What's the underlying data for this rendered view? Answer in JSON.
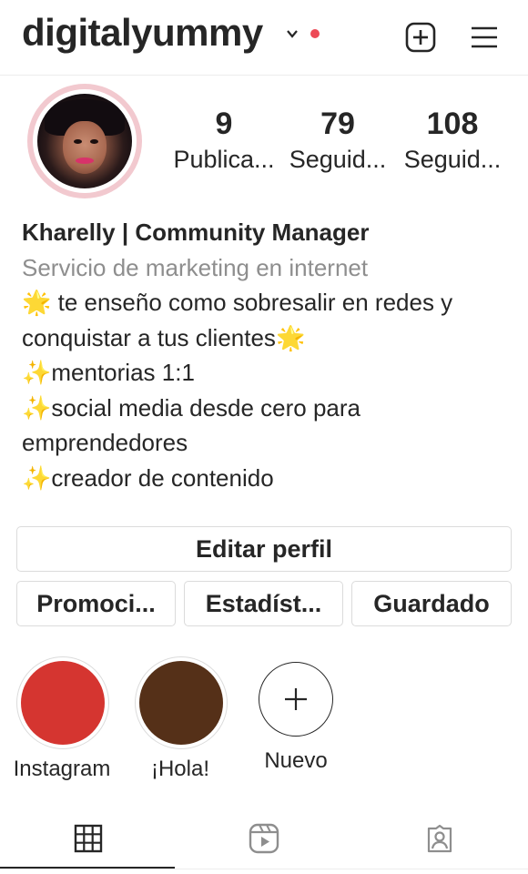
{
  "header": {
    "username": "digitalyummy",
    "chevron_icon": "chevron-down-icon",
    "notification_dot_color": "#ed4956",
    "new_post_icon": "plus-square-icon",
    "menu_icon": "hamburger-menu-icon"
  },
  "profile": {
    "avatar_ring_color": "#f2c9cf",
    "stats": [
      {
        "value": "9",
        "label": "Publica..."
      },
      {
        "value": "79",
        "label": "Seguid..."
      },
      {
        "value": "108",
        "label": "Seguid..."
      }
    ]
  },
  "bio": {
    "name": "Kharelly | Community Manager",
    "category": "Servicio de marketing en internet",
    "line1_emoji": "🌟",
    "line1": " te enseño como sobresalir en redes y",
    "line2": "conquistar a tus clientes",
    "line2_emoji": "🌟",
    "line3_emoji": "✨",
    "line3": "mentorias 1:1",
    "line4_emoji": "✨",
    "line4": "social media desde cero para",
    "line5": "emprendedores",
    "line6_emoji": "✨",
    "line6": "creador de contenido"
  },
  "buttons": {
    "edit_profile": "Editar perfil",
    "promotions": "Promoci...",
    "insights": "Estadíst...",
    "saved": "Guardado"
  },
  "highlights": [
    {
      "label": "Instagram",
      "color": "#d53530"
    },
    {
      "label": "¡Hola!",
      "color": "#553018"
    },
    {
      "label": "Nuevo",
      "icon": "plus-icon"
    }
  ],
  "tabs": [
    {
      "icon": "grid-icon",
      "active": true
    },
    {
      "icon": "reels-icon",
      "active": false
    },
    {
      "icon": "tagged-user-icon",
      "active": false
    }
  ]
}
